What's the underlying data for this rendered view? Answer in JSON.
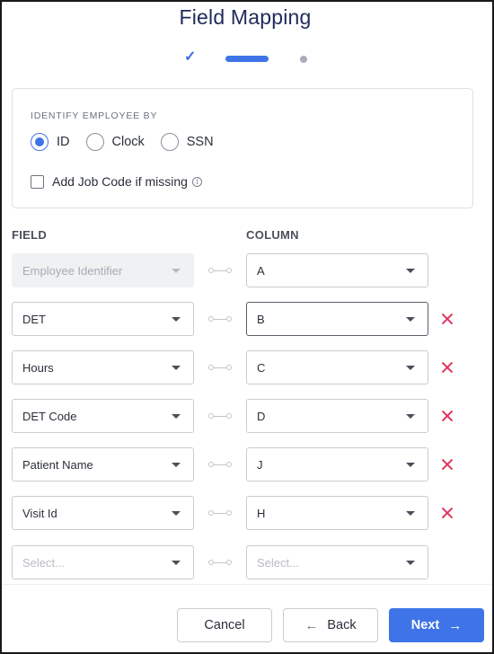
{
  "header": {
    "title": "Field Mapping"
  },
  "stepper": {
    "check_icon": "check-icon"
  },
  "identify": {
    "label": "IDENTIFY EMPLOYEE BY",
    "options": [
      {
        "label": "ID",
        "selected": true
      },
      {
        "label": "Clock",
        "selected": false
      },
      {
        "label": "SSN",
        "selected": false
      }
    ],
    "job_code_label": "Add Job Code if missing",
    "job_code_checked": false,
    "info_glyph": "i"
  },
  "mapping": {
    "field_header": "FIELD",
    "column_header": "COLUMN",
    "rows": [
      {
        "field": "Employee Identifier",
        "column": "A"
      },
      {
        "field": "DET",
        "column": "B"
      },
      {
        "field": "Hours",
        "column": "C"
      },
      {
        "field": "DET Code",
        "column": "D"
      },
      {
        "field": "Patient Name",
        "column": "J"
      },
      {
        "field": "Visit Id",
        "column": "H"
      },
      {
        "field": "Select...",
        "column": "Select..."
      }
    ]
  },
  "footer": {
    "cancel_label": "Cancel",
    "back_label": "Back",
    "next_label": "Next",
    "back_arrow": "←",
    "next_arrow": "→"
  },
  "colors": {
    "accent": "#3f74e8",
    "remove": "#e0335c",
    "title": "#1f2a5a"
  }
}
